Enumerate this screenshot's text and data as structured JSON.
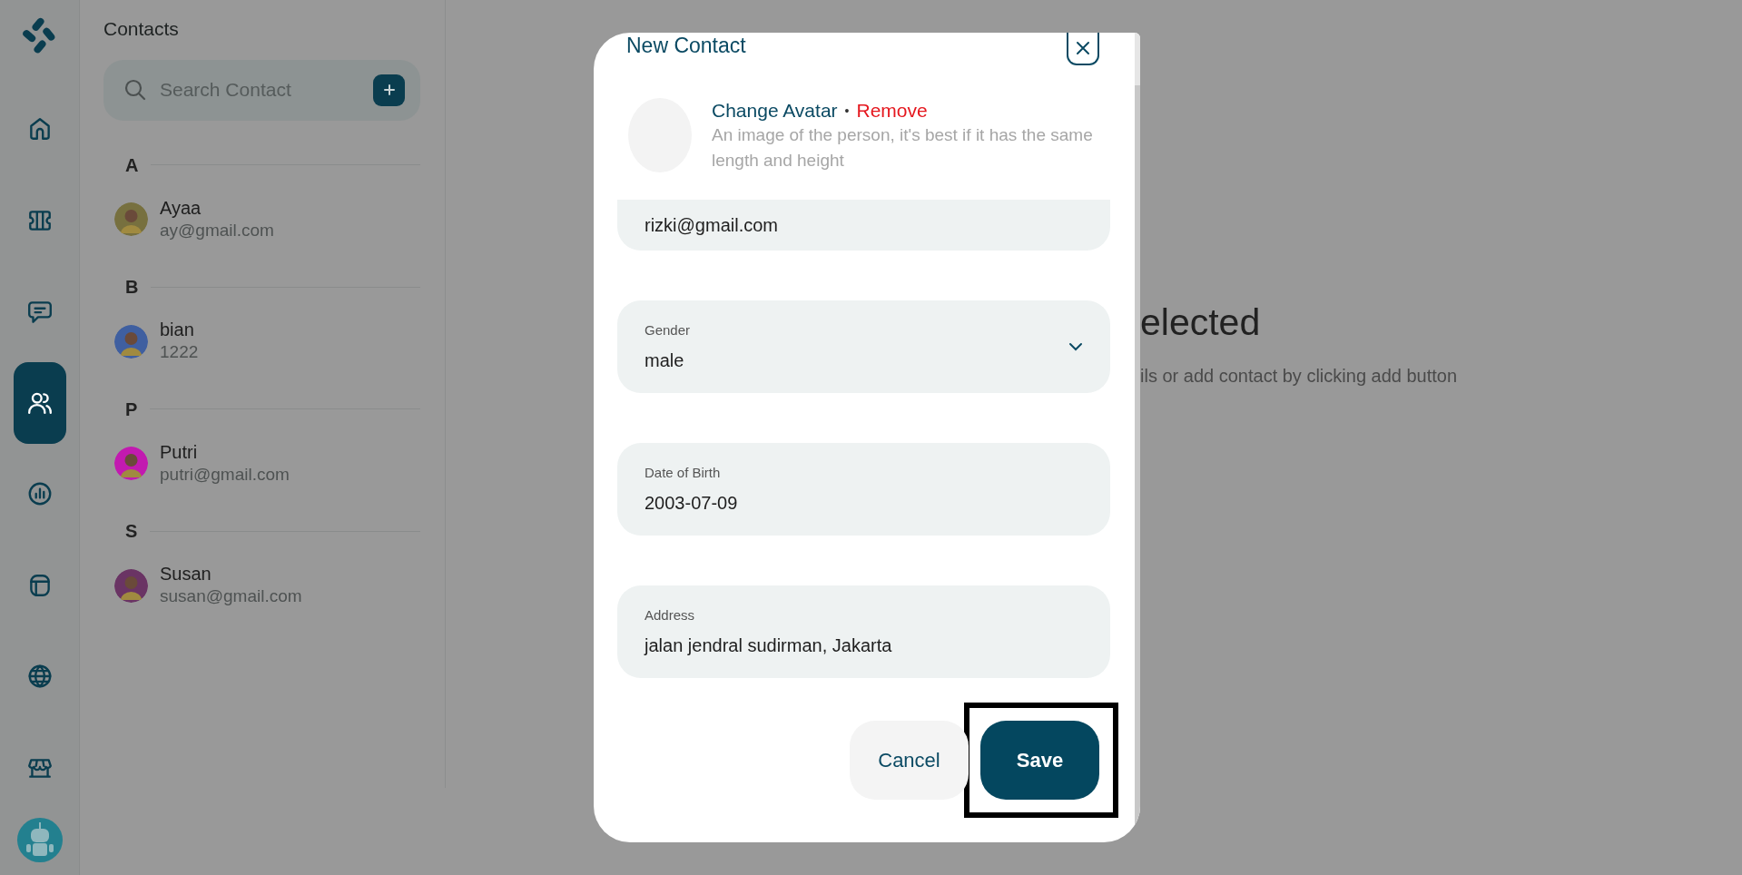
{
  "rail": {
    "items": [
      {
        "kind": "home",
        "selected": false
      },
      {
        "kind": "ticket",
        "selected": false
      },
      {
        "kind": "chat",
        "selected": false
      },
      {
        "kind": "contacts",
        "selected": true
      },
      {
        "kind": "chart",
        "selected": false
      },
      {
        "kind": "layout",
        "selected": false
      },
      {
        "kind": "globe",
        "selected": false
      },
      {
        "kind": "store",
        "selected": false
      }
    ]
  },
  "contacts_panel": {
    "title": "Contacts",
    "search": {
      "placeholder": "Search Contact"
    },
    "groups": [
      {
        "letter": "A",
        "contacts": [
          {
            "name": "Ayaa",
            "detail": "ay@gmail.com",
            "color": "#77703f"
          }
        ]
      },
      {
        "letter": "B",
        "contacts": [
          {
            "name": "bian",
            "detail": "1222",
            "color": "#3f5fa0"
          }
        ]
      },
      {
        "letter": "P",
        "contacts": [
          {
            "name": "Putri",
            "detail": "putri@gmail.com",
            "color": "#c21ab0"
          }
        ]
      },
      {
        "letter": "S",
        "contacts": [
          {
            "name": "Susan",
            "detail": "susan@gmail.com",
            "color": "#6a3464"
          }
        ]
      }
    ]
  },
  "empty_state": {
    "title": "elected",
    "subtitle": "ils or add contact by clicking add button"
  },
  "modal": {
    "title": "New Contact",
    "avatar": {
      "change": "Change Avatar",
      "separator": "•",
      "remove": "Remove",
      "hint": "An image of the person, it's best if it has the same length and height"
    },
    "fields": [
      {
        "kind": "text",
        "value": "rizki@gmail.com"
      },
      {
        "kind": "select",
        "label": "Gender",
        "value": "male"
      },
      {
        "kind": "text",
        "label": "Date of Birth",
        "value": "2003-07-09"
      },
      {
        "kind": "text",
        "label": "Address",
        "value": "jalan jendral sudirman, Jakarta"
      }
    ],
    "buttons": [
      {
        "label": "Cancel",
        "kind": "secondary",
        "highlighted": false
      },
      {
        "label": "Save",
        "kind": "primary",
        "highlighted": true
      }
    ]
  }
}
